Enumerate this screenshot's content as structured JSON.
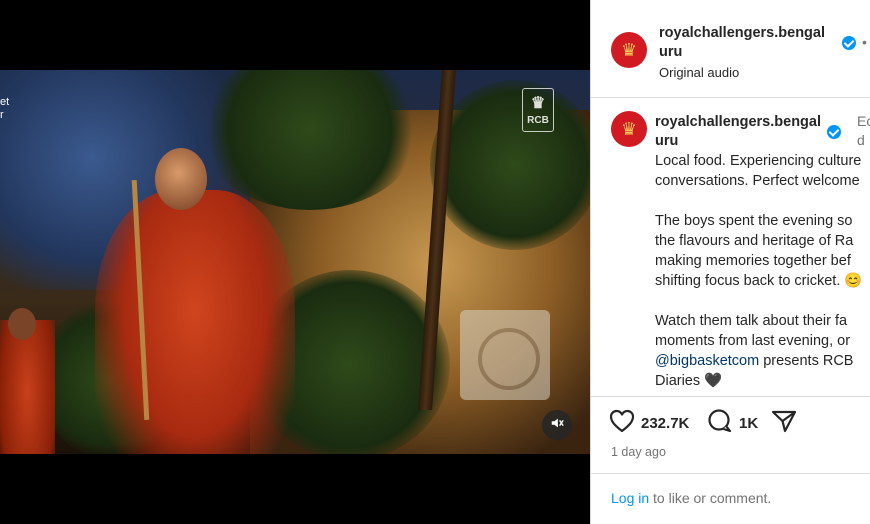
{
  "media": {
    "overlay_lines": [
      "et",
      "r"
    ],
    "logo_text": "RCB",
    "mute_icon": "speaker-muted-icon"
  },
  "post": {
    "username_line1": "royalchallengers.bengal",
    "username_line2": "uru",
    "audio": "Original audio",
    "more_dot": "•",
    "edited_line1": "Ec",
    "edited_line2": "d"
  },
  "caption": {
    "username_line1": "royalchallengers.bengal",
    "username_line2": "uru",
    "para1": "Local food. Experiencing culture\nconversations. Perfect welcome",
    "para2": "The boys spent the evening so\nthe flavours and heritage of Ra\nmaking memories together bef\nshifting focus back to cricket. 😊",
    "para3_a": "Watch them talk about their fa\nmoments from last evening, or\n",
    "mention": "@bigbasketcom",
    "para3_b": " presents RCB\nDiaries 🖤"
  },
  "stats": {
    "likes": "232.7K",
    "comments": "1K",
    "time_ago": "1 day ago"
  },
  "login": {
    "link": "Log in",
    "rest": " to like or comment."
  },
  "colors": {
    "brand_red": "#d11a22",
    "verified_blue": "#0095f6",
    "link_blue": "#0095f6",
    "mention_blue": "#00376b"
  }
}
